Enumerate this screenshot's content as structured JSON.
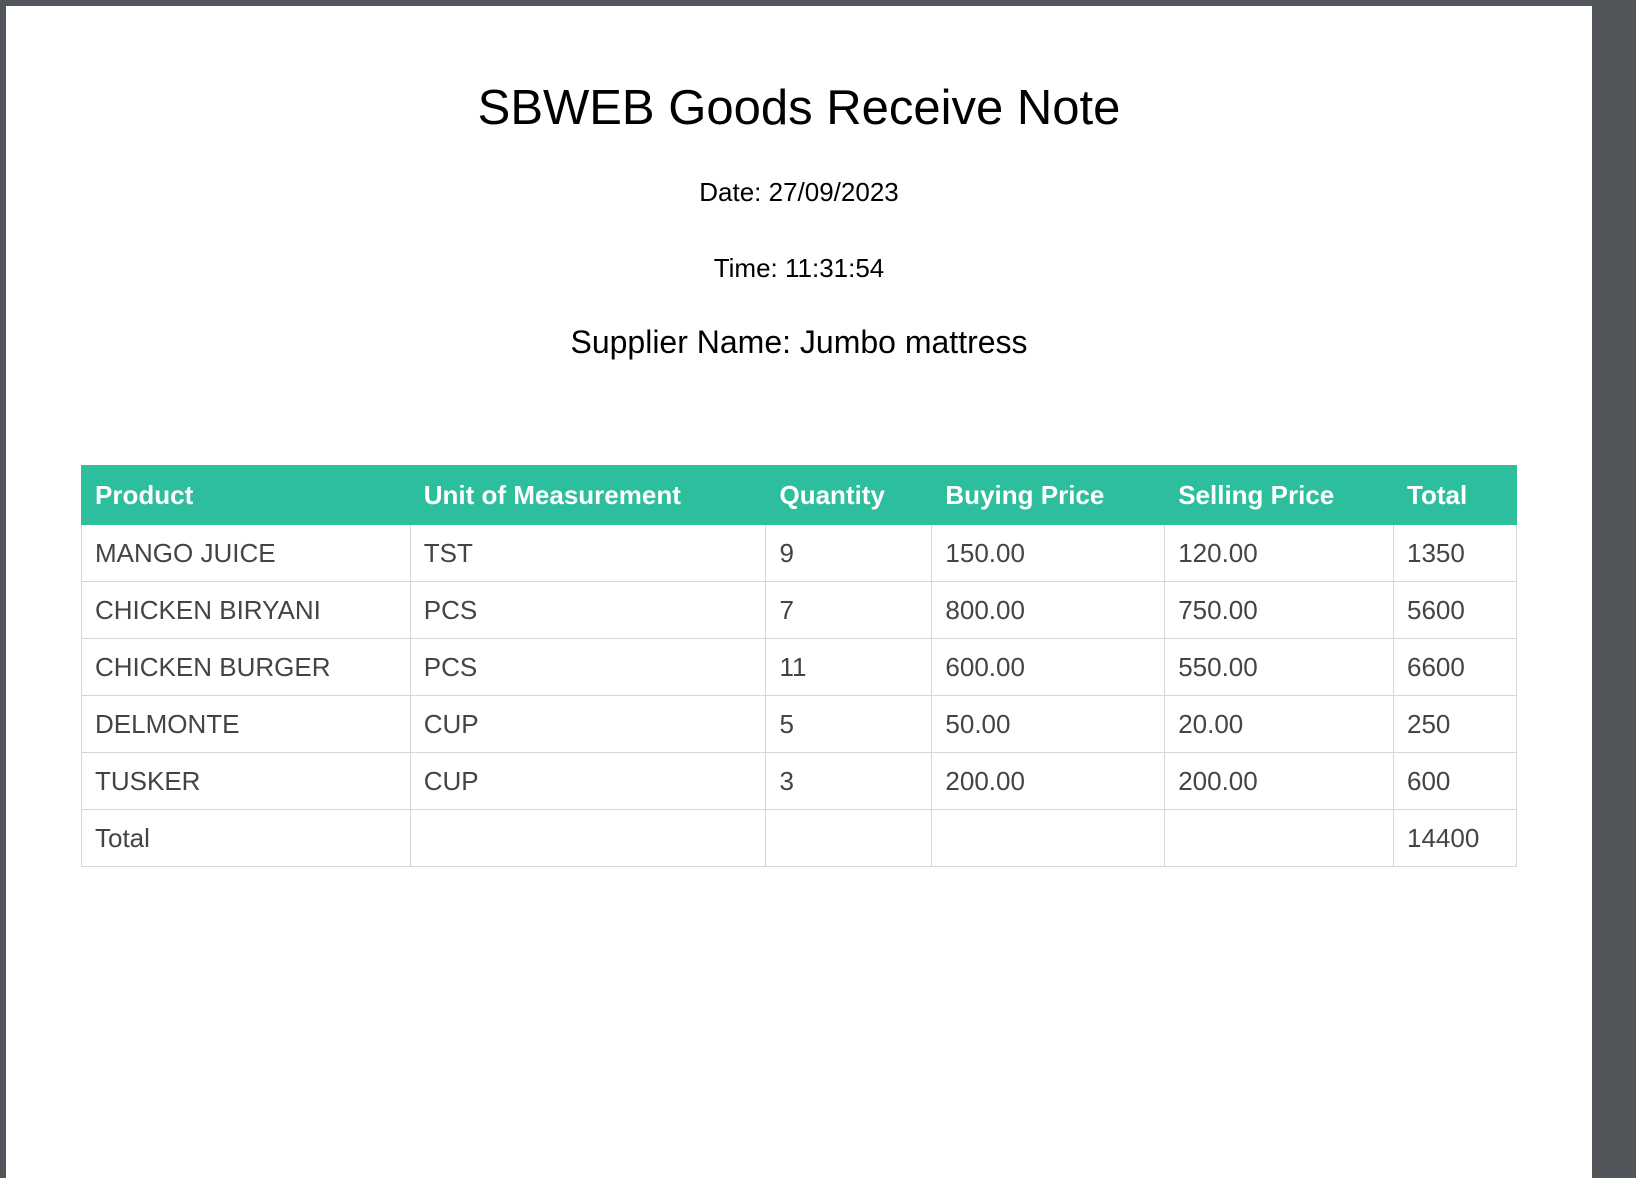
{
  "document": {
    "title": "SBWEB Goods Receive Note",
    "date_line": "Date: 27/09/2023",
    "time_line": "Time: 11:31:54",
    "supplier_line": "Supplier Name: Jumbo mattress"
  },
  "table": {
    "header_color": "#2dbe9d",
    "headers": [
      "Product",
      "Unit of Measurement",
      "Quantity",
      "Buying Price",
      "Selling Price",
      "Total"
    ],
    "rows": [
      [
        "MANGO JUICE",
        "TST",
        "9",
        "150.00",
        "120.00",
        "1350"
      ],
      [
        "CHICKEN BIRYANI",
        "PCS",
        "7",
        "800.00",
        "750.00",
        "5600"
      ],
      [
        "CHICKEN BURGER",
        "PCS",
        "11",
        "600.00",
        "550.00",
        "6600"
      ],
      [
        "DELMONTE",
        "CUP",
        "5",
        "50.00",
        "20.00",
        "250"
      ],
      [
        "TUSKER",
        "CUP",
        "3",
        "200.00",
        "200.00",
        "600"
      ]
    ],
    "total_row": [
      "Total",
      "",
      "",
      "",
      "",
      "14400"
    ]
  }
}
